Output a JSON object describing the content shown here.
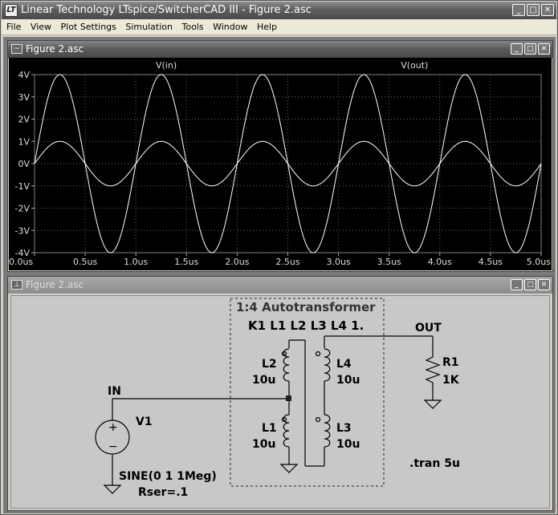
{
  "app": {
    "title": "Linear Technology LTspice/SwitcherCAD III - Figure 2.asc",
    "icon_name": "ltspice-app-icon"
  },
  "menu": [
    "File",
    "View",
    "Plot Settings",
    "Simulation",
    "Tools",
    "Window",
    "Help"
  ],
  "window_buttons": {
    "minimize": "_",
    "maximize": "□",
    "close": "✕"
  },
  "plot_window": {
    "title": "Figure 2.asc",
    "icon_name": "waveform-icon"
  },
  "schematic_window": {
    "title": "Figure 2.asc",
    "icon_name": "schematic-icon"
  },
  "chart_data": {
    "type": "line",
    "series": [
      {
        "name": "V(in)",
        "amplitude": 1,
        "frequency_mhz": 1,
        "color": "#ffffff"
      },
      {
        "name": "V(out)",
        "amplitude": 4,
        "frequency_mhz": 1,
        "color": "#ffffff"
      }
    ],
    "x": {
      "min": 0,
      "max": 5,
      "unit": "us",
      "tick_labels": [
        "0.0us",
        "0.5us",
        "1.0us",
        "1.5us",
        "2.0us",
        "2.5us",
        "3.0us",
        "3.5us",
        "4.0us",
        "4.5us",
        "5.0us"
      ]
    },
    "y": {
      "min": -4,
      "max": 4,
      "unit": "V",
      "tick_labels": [
        "4V",
        "3V",
        "2V",
        "1V",
        "0V",
        "-1V",
        "-2V",
        "-3V",
        "-4V"
      ]
    },
    "grid": true,
    "background": "#000000"
  },
  "schematic": {
    "box_title": "1:4 Autotransformer",
    "coupling": "K1 L1 L2 L3 L4 1.",
    "L2": {
      "name": "L2",
      "value": "10u"
    },
    "L1": {
      "name": "L1",
      "value": "10u"
    },
    "L4": {
      "name": "L4",
      "value": "10u"
    },
    "L3": {
      "name": "L3",
      "value": "10u"
    },
    "R1": {
      "name": "R1",
      "value": "1K"
    },
    "V1": {
      "name": "V1",
      "value": "SINE(0 1 1Meg)",
      "rser": "Rser=.1"
    },
    "net_in": "IN",
    "net_out": "OUT",
    "directive": ".tran 5u"
  }
}
